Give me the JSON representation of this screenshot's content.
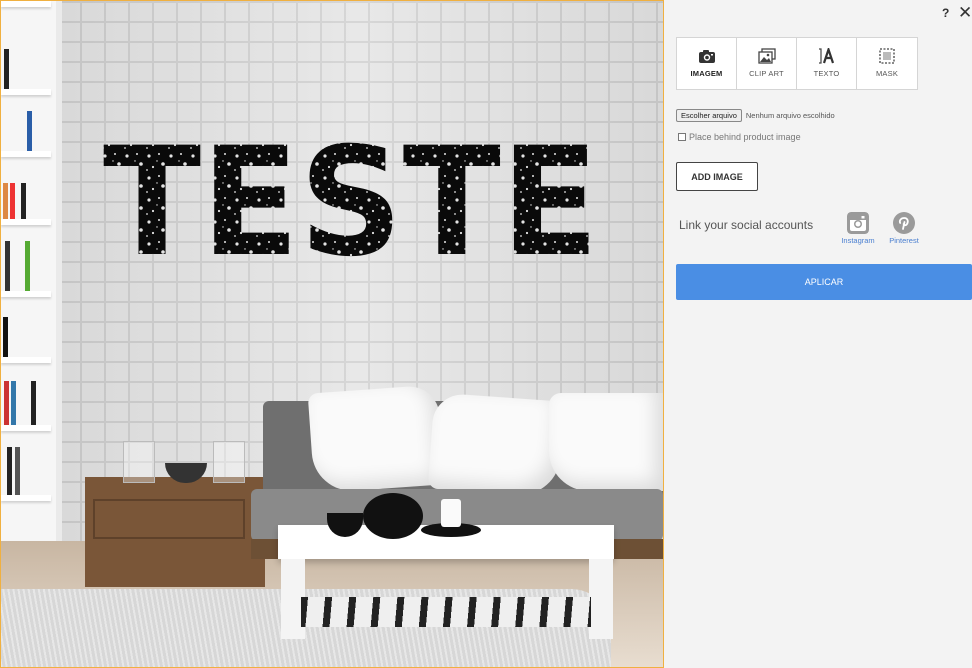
{
  "preview": {
    "decal_text": "TESTE",
    "frame_color": "#f0b040"
  },
  "header": {
    "help_label": "?",
    "close_label": "✕"
  },
  "tabs": [
    {
      "label": "IMAGEM",
      "icon": "camera-icon",
      "active": true
    },
    {
      "label": "CLIP ART",
      "icon": "images-icon",
      "active": false
    },
    {
      "label": "TEXTO",
      "icon": "text-icon",
      "active": false
    },
    {
      "label": "MASK",
      "icon": "mask-icon",
      "active": false
    }
  ],
  "upload": {
    "button_label": "Escolher arquivo",
    "status": "Nenhum arquivo escolhido",
    "checkbox_label": "Place behind product image",
    "checkbox_checked": false,
    "add_button_label": "ADD IMAGE"
  },
  "social": {
    "label": "Link your social accounts",
    "accounts": [
      {
        "name": "Instagram",
        "icon": "instagram-icon"
      },
      {
        "name": "Pinterest",
        "icon": "pinterest-icon"
      }
    ]
  },
  "apply_label": "APLICAR",
  "colors": {
    "accent": "#4a8ee4",
    "link": "#4a7fd0",
    "panel_bg": "#f3f3f3"
  }
}
